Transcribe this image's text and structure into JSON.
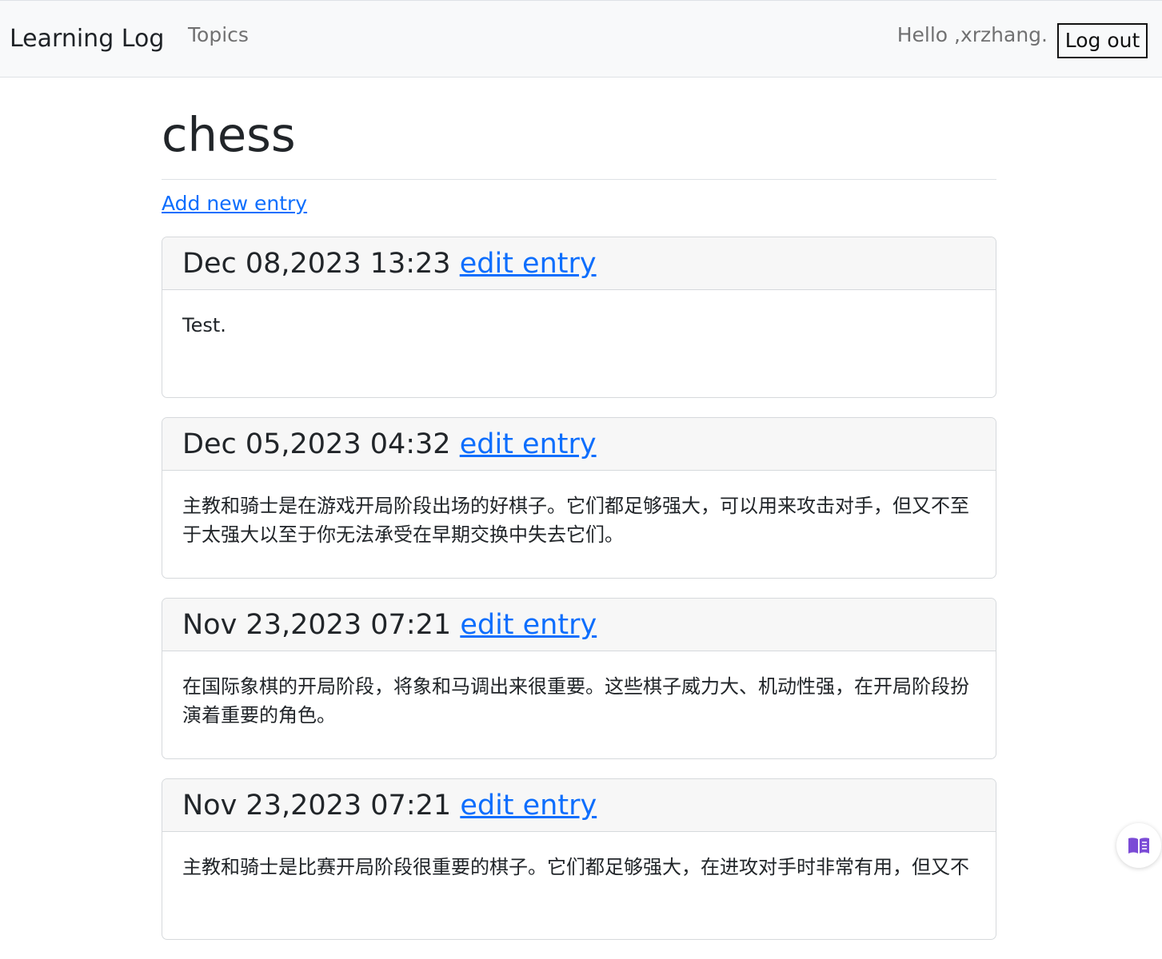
{
  "navbar": {
    "brand": "Learning Log",
    "topics_link": "Topics",
    "greeting": "Hello ,xrzhang.",
    "logout_button": "Log out"
  },
  "page": {
    "title": "chess",
    "add_entry_link": "Add new entry"
  },
  "entries": [
    {
      "date": "Dec 08,2023 13:23",
      "edit_label": "edit entry",
      "text": "Test."
    },
    {
      "date": "Dec 05,2023 04:32",
      "edit_label": "edit entry",
      "text": "主教和骑士是在游戏开局阶段出场的好棋子。它们都足够强大，可以用来攻击对手，但又不至于太强大以至于你无法承受在早期交换中失去它们。"
    },
    {
      "date": "Nov 23,2023 07:21",
      "edit_label": "edit entry",
      "text": "在国际象棋的开局阶段，将象和马调出来很重要。这些棋子威力大、机动性强，在开局阶段扮演着重要的角色。"
    },
    {
      "date": "Nov 23,2023 07:21",
      "edit_label": "edit entry",
      "text": "主教和骑士是比赛开局阶段很重要的棋子。它们都足够强大，在进攻对手时非常有用，但又不"
    }
  ],
  "icons": {
    "floating_button": "book-icon"
  },
  "colors": {
    "link": "#0d6efd",
    "navbar_bg": "#f8f9fa",
    "book_icon": "#7b4bd6"
  }
}
